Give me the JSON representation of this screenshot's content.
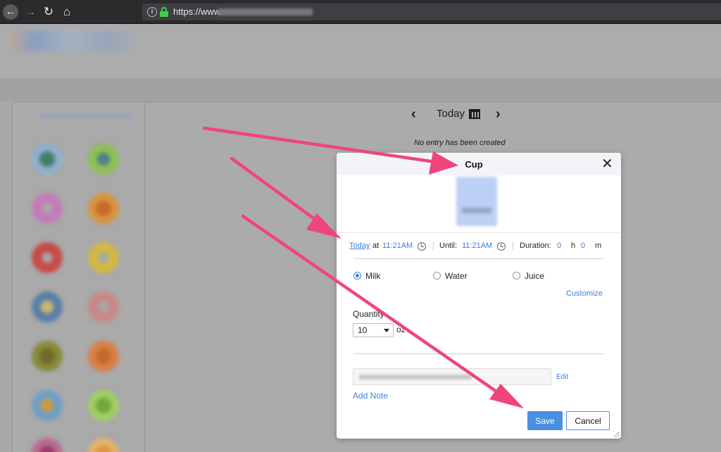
{
  "browser": {
    "url": "https://www.",
    "icons": [
      "back-icon",
      "forward-icon",
      "reload-icon",
      "home-icon",
      "info-icon",
      "lock-icon"
    ]
  },
  "date_nav": {
    "prev_icon": "chevron-left-icon",
    "label": "Today",
    "next_icon": "chevron-right-icon",
    "calendar_icon": "calendar-icon"
  },
  "empty_message": "No entry has been created",
  "modal": {
    "title": "Cup",
    "close_label": "✕",
    "time": {
      "start_day": "Today",
      "at": "at",
      "start_time": "11:21AM",
      "until_label": "Until:",
      "until_time": "11:21AM",
      "duration_label": "Duration:",
      "hours": "0",
      "hours_unit": "h",
      "minutes": "0",
      "minutes_unit": "m"
    },
    "options": [
      {
        "label": "Milk",
        "selected": true
      },
      {
        "label": "Water",
        "selected": false
      },
      {
        "label": "Juice",
        "selected": false
      }
    ],
    "customize_label": "Customize",
    "quantity": {
      "label": "Quantity",
      "value": "10",
      "unit": "oz"
    },
    "edit_label": "Edit",
    "add_note_label": "Add Note",
    "save_label": "Save",
    "cancel_label": "Cancel"
  },
  "colors": {
    "accent": "#4a90e2",
    "link": "#3b82d6",
    "arrow": "#f0457a",
    "overlay": "#a9a9a9"
  }
}
